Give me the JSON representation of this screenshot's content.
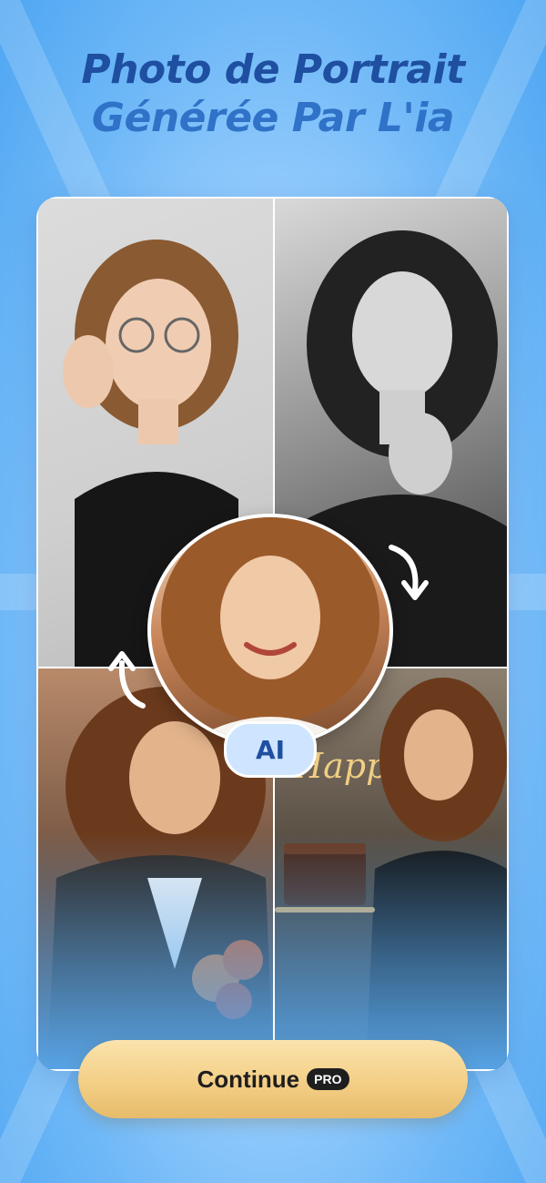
{
  "header": {
    "title_line1": "Photo de Portrait",
    "title_line2": "Générée Par L'ia"
  },
  "grid": {
    "photos": [
      {
        "name": "portrait-glasses"
      },
      {
        "name": "portrait-bw"
      },
      {
        "name": "portrait-jacket-flowers"
      },
      {
        "name": "portrait-birthday-cake"
      }
    ],
    "birthday_sign": "Happy Birthday"
  },
  "center": {
    "badge": "AI"
  },
  "cta": {
    "label": "Continue",
    "badge": "PRO"
  },
  "colors": {
    "title_dark": "#1f4fa0",
    "title_light": "#2f72c8",
    "cta_gold": "#f3cf86",
    "background_blue": "#6fb8f7"
  }
}
